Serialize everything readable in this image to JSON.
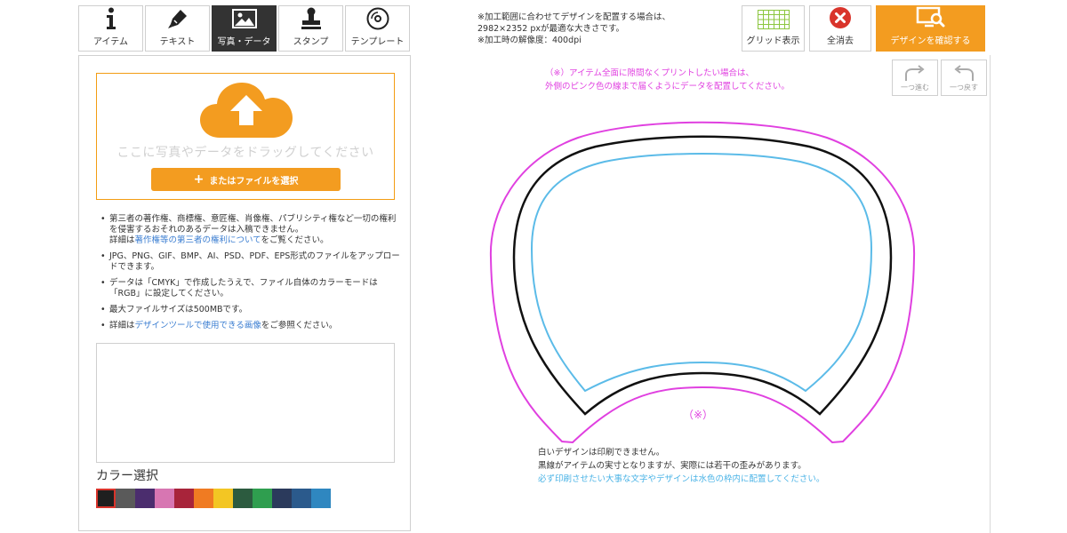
{
  "tabs": [
    {
      "label": "アイテム",
      "icon": "info-icon"
    },
    {
      "label": "テキスト",
      "icon": "pen-icon"
    },
    {
      "label": "写真・データ",
      "icon": "image-icon",
      "active": true
    },
    {
      "label": "スタンプ",
      "icon": "stamp-icon"
    },
    {
      "label": "テンプレート",
      "icon": "disc-icon"
    }
  ],
  "upload": {
    "drop_text": "ここに写真やデータをドラッグしてください",
    "file_button": "またはファイルを選択"
  },
  "notes": {
    "n1_a": "第三者の著作権、商標権、意匠権、肖像権、パブリシティ権など一切の権利を侵害するおそれのあるデータは入稿できません。",
    "n1_b_prefix": "詳細は",
    "n1_b_link": "著作権等の第三者の権利について",
    "n1_b_suffix": "をご覧ください。",
    "n2": "JPG、PNG、GIF、BMP、AI、PSD、PDF、EPS形式のファイルをアップロードできます。",
    "n3": "データは「CMYK」で作成したうえで、ファイル自体のカラーモードは「RGB」に設定してください。",
    "n4": "最大ファイルサイズは500MBです。",
    "n5_prefix": "詳細は",
    "n5_link": "デザインツールで使用できる画像",
    "n5_suffix": "をご参照ください。"
  },
  "color_select": {
    "title": "カラー選択",
    "swatches": [
      "#1f1f1f",
      "#5a5a5a",
      "#4b2d6e",
      "#d776b2",
      "#a8243a",
      "#f07b22",
      "#f3c623",
      "#2c5b3f",
      "#2f9e4f",
      "#2b3a5c",
      "#2b5a8c",
      "#2f87c0"
    ]
  },
  "spec": {
    "line1": "※加工範囲に合わせてデザインを配置する場合は、",
    "line2": "2982×2352 pxが最適な大きさです。",
    "line3": "※加工時の解像度：400dpi"
  },
  "toolbar": {
    "grid": "グリッド表示",
    "clear": "全消去",
    "confirm": "デザインを確認する",
    "redo": "一つ進む",
    "undo": "一つ戻す"
  },
  "canvas": {
    "pink_note_1": "（※）アイテム全面に隙間なくプリントしたい場合は、",
    "pink_note_2": "外側のピンク色の線まで届くようにデータを配置してください。",
    "mark": "（※）",
    "bottom_1": "白いデザインは印刷できません。",
    "bottom_2": "黒線がアイテムの実寸となりますが、実際には若干の歪みがあります。",
    "bottom_3": "必ず印刷させたい大事な文字やデザインは水色の枠内に配置してください。"
  },
  "colors": {
    "accent": "#f39c20",
    "pink": "#e040e0",
    "blue": "#4ab3e6",
    "clear_red": "#d9342b",
    "grid_green": "#8cc63f"
  }
}
